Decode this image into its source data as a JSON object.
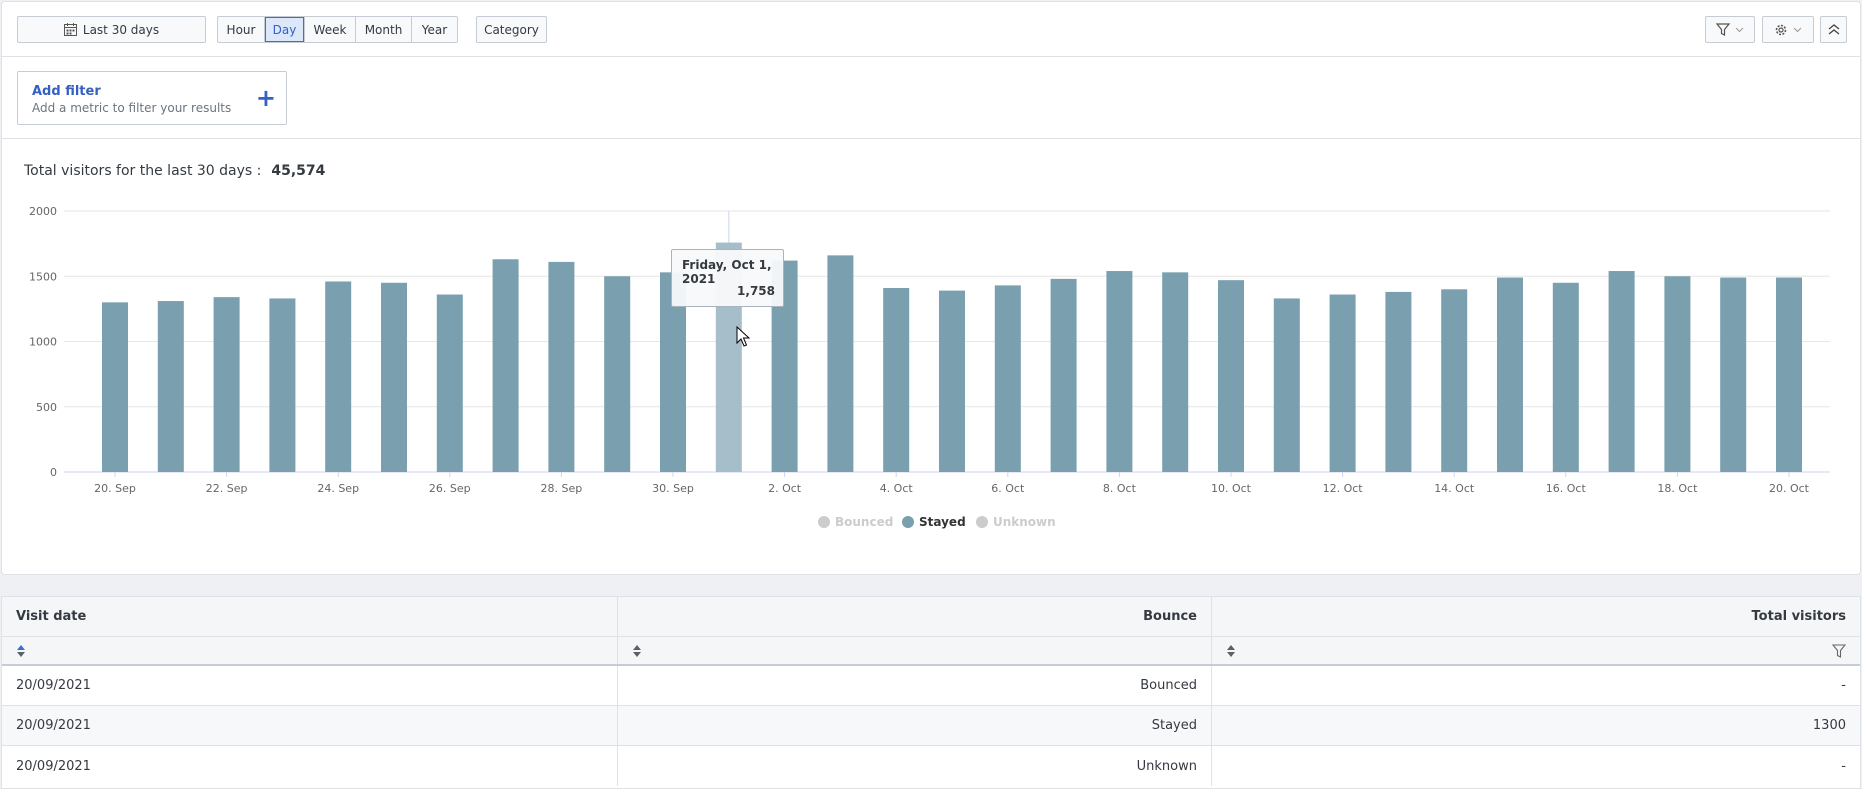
{
  "toolbar": {
    "date_range_label": "Last 30 days",
    "granularity": [
      "Hour",
      "Day",
      "Week",
      "Month",
      "Year"
    ],
    "active_granularity": "Day",
    "category_label": "Category"
  },
  "filter": {
    "title": "Add filter",
    "subtitle": "Add a metric to filter your results",
    "plus": "+"
  },
  "summary": {
    "label": "Total visitors for the last 30 days :",
    "value": "45,574"
  },
  "tooltip": {
    "date": "Friday, Oct 1, 2021",
    "value": "1,758"
  },
  "chart_data": {
    "type": "bar",
    "categories": [
      "20. Sep",
      "21. Sep",
      "22. Sep",
      "23. Sep",
      "24. Sep",
      "25. Sep",
      "26. Sep",
      "27. Sep",
      "28. Sep",
      "29. Sep",
      "30. Sep",
      "1. Oct",
      "2. Oct",
      "3. Oct",
      "4. Oct",
      "5. Oct",
      "6. Oct",
      "7. Oct",
      "8. Oct",
      "9. Oct",
      "10. Oct",
      "11. Oct",
      "12. Oct",
      "13. Oct",
      "14. Oct",
      "15. Oct",
      "16. Oct",
      "17. Oct",
      "18. Oct",
      "19. Oct",
      "20. Oct"
    ],
    "x_tick_labels": [
      "20. Sep",
      "22. Sep",
      "24. Sep",
      "26. Sep",
      "28. Sep",
      "30. Sep",
      "2. Oct",
      "4. Oct",
      "6. Oct",
      "8. Oct",
      "10. Oct",
      "12. Oct",
      "14. Oct",
      "16. Oct",
      "18. Oct",
      "20. Oct"
    ],
    "series": [
      {
        "name": "Bounced",
        "values": [],
        "color": "#cccccc",
        "visible": false
      },
      {
        "name": "Stayed",
        "values": [
          1300,
          1310,
          1340,
          1330,
          1460,
          1450,
          1360,
          1630,
          1610,
          1500,
          1530,
          1758,
          1620,
          1660,
          1410,
          1390,
          1430,
          1480,
          1540,
          1530,
          1470,
          1330,
          1360,
          1380,
          1400,
          1490,
          1450,
          1540,
          1500,
          1490,
          1490
        ],
        "color": "#7a9fae",
        "visible": true
      },
      {
        "name": "Unknown",
        "values": [],
        "color": "#cccccc",
        "visible": false
      }
    ],
    "y_ticks": [
      "0",
      "500",
      "1000",
      "1500",
      "2000"
    ],
    "ylim": [
      0,
      2000
    ],
    "highlighted_index": 11,
    "legend_position": "bottom-center",
    "grid": true
  },
  "table": {
    "headers": [
      "Visit date",
      "Bounce",
      "Total visitors"
    ],
    "rows": [
      [
        "20/09/2021",
        "Bounced",
        "-"
      ],
      [
        "20/09/2021",
        "Stayed",
        "1300"
      ],
      [
        "20/09/2021",
        "Unknown",
        "-"
      ]
    ]
  }
}
